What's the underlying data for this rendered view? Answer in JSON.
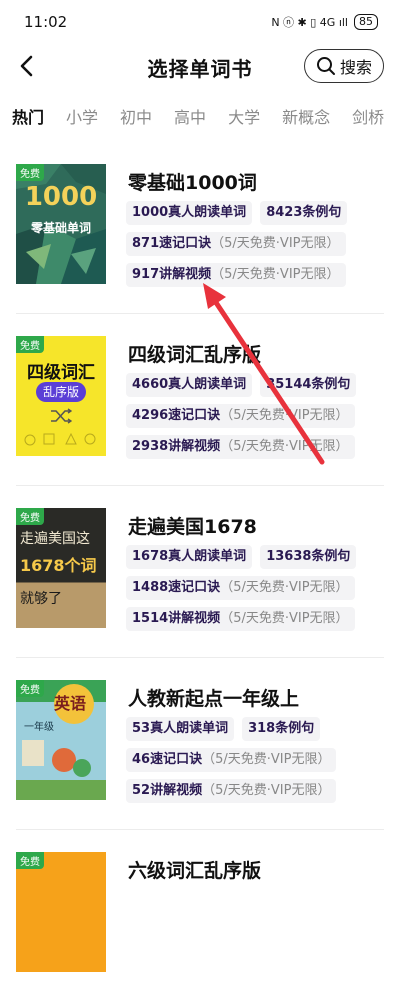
{
  "status": {
    "time": "11:02",
    "icons": "N ⓝ ✱ ▯ 4G ıll",
    "battery": "85"
  },
  "nav": {
    "title": "选择单词书",
    "search_label": "搜索"
  },
  "tabs": [
    "热门",
    "小学",
    "初中",
    "高中",
    "大学",
    "新概念",
    "剑桥"
  ],
  "books": [
    {
      "title": "零基础1000词",
      "free": "免费",
      "cover_text": [
        "1000",
        "零基础单词"
      ],
      "chips": [
        [
          "1000真人朗读单词",
          "8423条例句"
        ],
        [
          "871速记口诀",
          "（5/天免费·VIP无限）"
        ],
        [
          "917讲解视频",
          "（5/天免费·VIP无限）"
        ]
      ]
    },
    {
      "title": "四级词汇乱序版",
      "free": "免费",
      "cover_text": [
        "四级词汇",
        "乱序版"
      ],
      "chips": [
        [
          "4660真人朗读单词",
          "35144条例句"
        ],
        [
          "4296速记口诀",
          "（5/天免费·VIP无限）"
        ],
        [
          "2938讲解视频",
          "（5/天免费·VIP无限）"
        ]
      ]
    },
    {
      "title": "走遍美国1678",
      "free": "免费",
      "cover_text": [
        "走遍美国这",
        "1678个词",
        "就够了"
      ],
      "chips": [
        [
          "1678真人朗读单词",
          "13638条例句"
        ],
        [
          "1488速记口诀",
          "（5/天免费·VIP无限）"
        ],
        [
          "1514讲解视频",
          "（5/天免费·VIP无限）"
        ]
      ]
    },
    {
      "title": "人教新起点一年级上",
      "free": "免费",
      "cover_text": [
        "英语",
        "一年级"
      ],
      "chips": [
        [
          "53真人朗读单词",
          "318条例句"
        ],
        [
          "46速记口诀",
          "（5/天免费·VIP无限）"
        ],
        [
          "52讲解视频",
          "（5/天免费·VIP无限）"
        ]
      ]
    },
    {
      "title": "六级词汇乱序版",
      "free": "免费",
      "cover_text": [],
      "chips": []
    }
  ],
  "colors": {
    "accent_arrow": "#e8323c",
    "free_badge": "#2ea84a"
  }
}
